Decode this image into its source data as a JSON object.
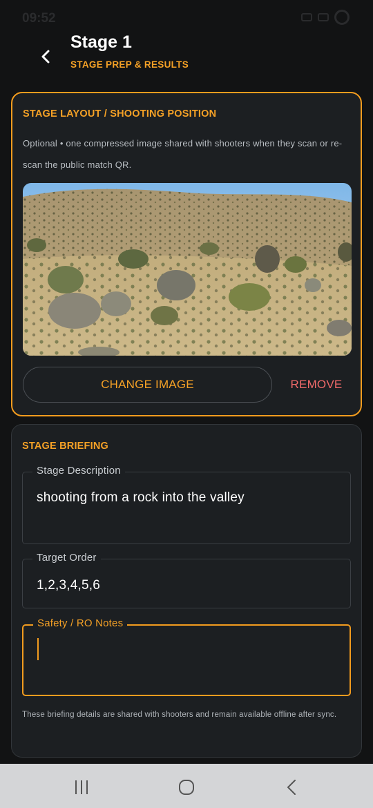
{
  "status_bar": {
    "time": "09:52"
  },
  "header": {
    "title": "Stage 1",
    "subtitle": "STAGE PREP & RESULTS",
    "back_icon": "chevron-left-icon"
  },
  "layout_card": {
    "title": "STAGE LAYOUT / SHOOTING POSITION",
    "helper": "Optional • one compressed image shared with shooters when they scan or re-scan the public match QR.",
    "change_button": "CHANGE IMAGE",
    "remove_button": "REMOVE"
  },
  "briefing_card": {
    "title": "STAGE BRIEFING",
    "description": {
      "label": "Stage Description",
      "value": "shooting from a rock into the valley"
    },
    "target_order": {
      "label": "Target Order",
      "value": "1,2,3,4,5,6"
    },
    "safety_notes": {
      "label": "Safety / RO Notes",
      "value": ""
    },
    "helper": "These briefing details are shared with shooters and remain available offline after sync."
  },
  "colors": {
    "accent": "#f5a126",
    "danger": "#f06a6a",
    "background": "#121314",
    "card": "#1c1f22"
  }
}
